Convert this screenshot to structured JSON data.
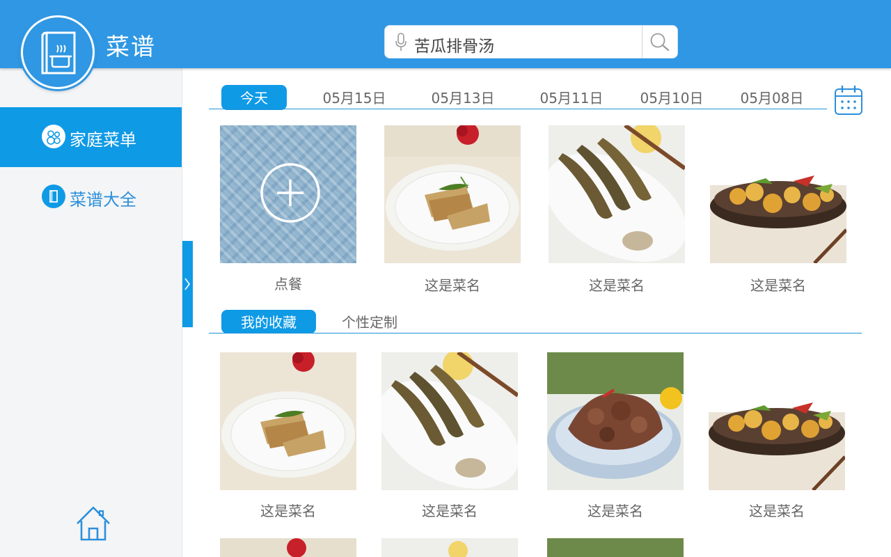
{
  "header": {
    "app_title": "菜谱",
    "search": {
      "value": "苦瓜排骨汤",
      "mic_icon": "microphone-icon",
      "search_icon": "search-icon"
    },
    "brand_color": "#2f97e3"
  },
  "sidebar": {
    "items": [
      {
        "label": "家庭菜单",
        "icon": "family-icon",
        "active": true
      },
      {
        "label": "菜谱大全",
        "icon": "book-icon",
        "active": false
      }
    ],
    "home_icon": "home-icon",
    "accent_color": "#0f9ae6"
  },
  "date_tabs": {
    "items": [
      "今天",
      "05月15日",
      "05月13日",
      "05月11日",
      "05月10日",
      "05月08日"
    ],
    "active_index": 0,
    "calendar_icon": "calendar-icon"
  },
  "today_dishes": {
    "add_label": "点餐",
    "items": [
      {
        "name": "这是菜名",
        "image": "fish-fillet-plate"
      },
      {
        "name": "这是菜名",
        "image": "fried-small-fish"
      },
      {
        "name": "这是菜名",
        "image": "cauliflower-bowl"
      }
    ]
  },
  "fav_tabs": {
    "items": [
      "我的收藏",
      "个性定制"
    ],
    "active_index": 0
  },
  "fav_dishes": {
    "items": [
      {
        "name": "这是菜名",
        "image": "fish-fillet-plate"
      },
      {
        "name": "这是菜名",
        "image": "fried-small-fish"
      },
      {
        "name": "这是菜名",
        "image": "braised-meat-bowl"
      },
      {
        "name": "这是菜名",
        "image": "cauliflower-bowl"
      }
    ]
  }
}
